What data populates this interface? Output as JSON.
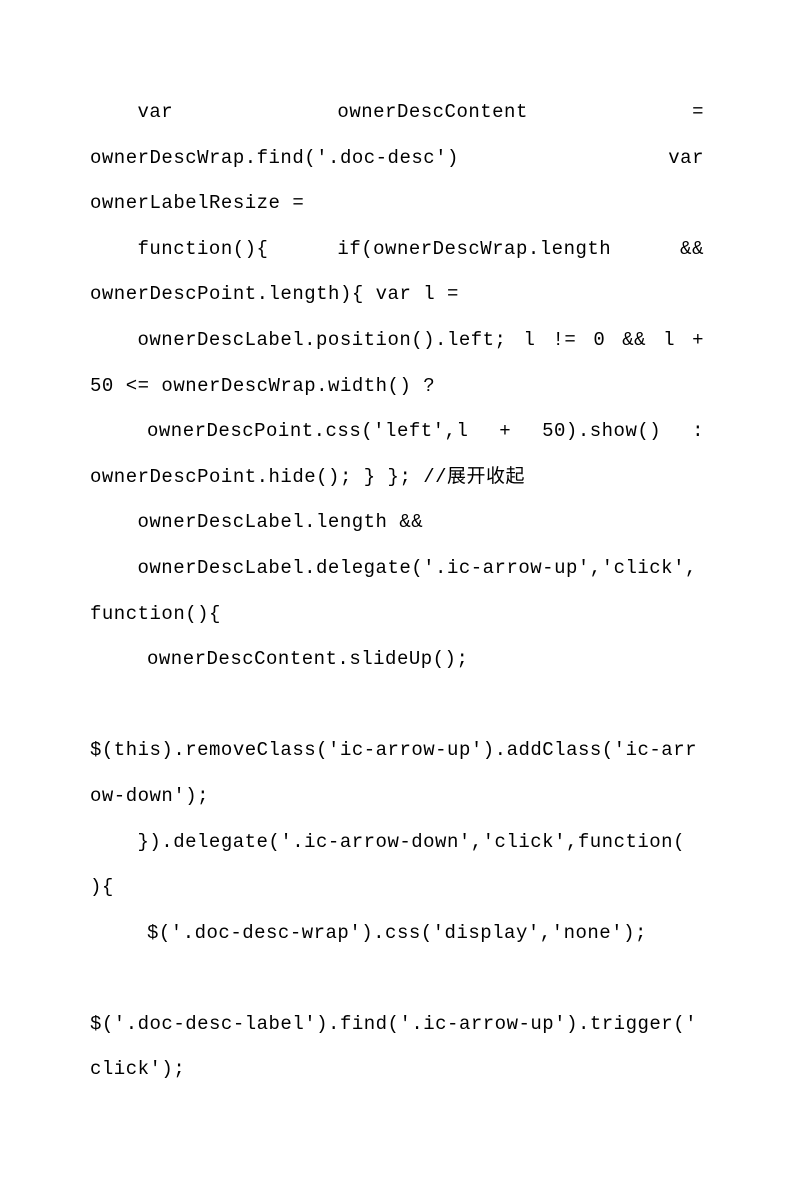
{
  "lines": [
    {
      "cls": "line indent1 justify",
      "text": "var            ownerDescContent           ="
    },
    {
      "cls": "line justify",
      "text": "ownerDescWrap.find('.doc-desc')               var"
    },
    {
      "cls": "line",
      "text": "ownerLabelResize ="
    },
    {
      "cls": "line indent1 justify",
      "text": "function(){     if(ownerDescWrap.length     &&"
    },
    {
      "cls": "line",
      "text": "ownerDescPoint.length){ var l ="
    },
    {
      "cls": "line indent1 justify",
      "text": "ownerDescLabel.position().left;  l  !=  0  &&  l  +"
    },
    {
      "cls": "line",
      "text": "50 <= ownerDescWrap.width() ?"
    },
    {
      "cls": "line indent2 justify",
      "text": "ownerDescPoint.css('left',l   +   50).show()   :"
    },
    {
      "cls": "line",
      "text": "ownerDescPoint.hide(); } }; //展开收起"
    },
    {
      "cls": "line indent1",
      "text": "ownerDescLabel.length &&"
    },
    {
      "cls": "line indent1",
      "text": "ownerDescLabel.delegate('.ic-arrow-up','click',"
    },
    {
      "cls": "line",
      "text": "function(){"
    },
    {
      "cls": "line indent2",
      "text": "ownerDescContent.slideUp();"
    },
    {
      "cls": "line",
      "text": " "
    },
    {
      "cls": "line",
      "text": "$(this).removeClass('ic-arrow-up').addClass('ic-arr"
    },
    {
      "cls": "line",
      "text": "ow-down');"
    },
    {
      "cls": "line indent1",
      "text": "}).delegate('.ic-arrow-down','click',function("
    },
    {
      "cls": "line",
      "text": "){"
    },
    {
      "cls": "line indent2",
      "text": "$('.doc-desc-wrap').css('display','none');"
    },
    {
      "cls": "line",
      "text": " "
    },
    {
      "cls": "line",
      "text": "$('.doc-desc-label').find('.ic-arrow-up').trigger('"
    },
    {
      "cls": "line",
      "text": "click');"
    }
  ]
}
